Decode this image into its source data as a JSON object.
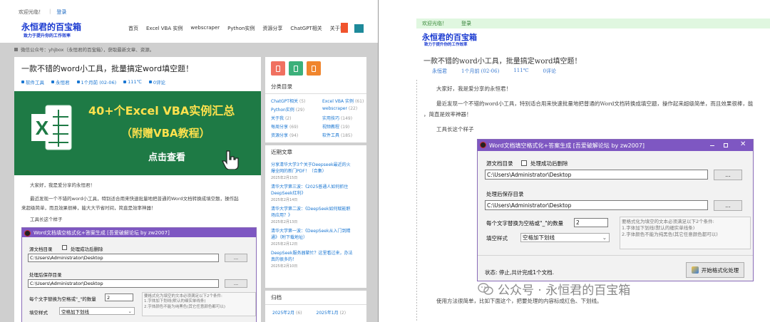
{
  "left": {
    "top_welcome": "欢迎光临！",
    "top_login": "登录",
    "site_name": "永恒君的百宝箱",
    "slogan": "致力于提升你的工作效率",
    "nav": [
      "首页",
      "Excel VBA 实例",
      "webscraper",
      "Python实例",
      "资源分享",
      "ChatGPT相关",
      "关于我"
    ],
    "breadcrumb": "微信公众号：yhjbox（永恒君的百宝箱），获取最新文章、资源。",
    "article_title": "一款不错的word小工具，批量搞定word填空题！",
    "meta": [
      "软件工具",
      "永恒君",
      "1个月前 (02-06)",
      "111℃",
      "0评论"
    ],
    "banner": {
      "line1": "40+个Excel VBA实例汇总",
      "line2": "（附赠VBA教程）",
      "line3": "点击查看"
    },
    "para1": "大家好，我是爱分享的永恒君！",
    "para2a": "最近发现一个不错的word小工具，特别适合用来快速批量地把普通的Word文档转换成填空题，操作起",
    "para2b": "来超级简单，而且效果很棒，能大大节省时间，简直是效率神器！",
    "para3": "工具长这个样子",
    "sidebar": {
      "colors": {
        "red": "#f07060",
        "green": "#3bb07a",
        "orange": "#f0852d"
      },
      "cat_heading": "分类目录",
      "categories": [
        {
          "name": "ChatGPT相关",
          "count": "(5)"
        },
        {
          "name": "Excel VBA 实例",
          "count": "(61)"
        },
        {
          "name": "Python实例",
          "count": "(29)"
        },
        {
          "name": "webscraper",
          "count": "(22)"
        },
        {
          "name": "关于我",
          "count": "(2)"
        },
        {
          "name": "实用技巧",
          "count": "(149)"
        },
        {
          "name": "每周分享",
          "count": "(69)"
        },
        {
          "name": "视频教程",
          "count": "(19)"
        },
        {
          "name": "资源分享",
          "count": "(94)"
        },
        {
          "name": "软件工具",
          "count": "(185)"
        }
      ],
      "recent_heading": "近期文章",
      "recent": [
        {
          "title_a": "分享清华大学3个关于Deepseek最近的火",
          "title_b": "爆全网的新门PDF！（合集）",
          "date": "2025年2月15日"
        },
        {
          "title_a": "清华大学第三波：《2025普通人如何抓住",
          "title_b": "DeepSeek红利》",
          "date": "2025年2月14日"
        },
        {
          "title_a": "清华大学第二波：《DeepSeek如何赋能职",
          "title_b": "场应用？》",
          "date": "2025年2月13日"
        },
        {
          "title_a": "清华大学第一波：《DeepSeek从入门到精",
          "title_b": "通》（附下载地址）",
          "date": "2025年2月12日"
        },
        {
          "title_a": "DeepSeek服务器繁忙？这里看过来，办法",
          "title_b": "真的很多的！",
          "date": "2025年2月10日"
        }
      ],
      "archive_heading": "归档",
      "archive": [
        "2025年2月",
        "(6)",
        "2025年1月",
        "(2)"
      ]
    }
  },
  "dialog": {
    "title": "Word文档填空格式化+答案生成 [吾爱破解论坛 by zw2007]",
    "source_label": "源文档目录",
    "delete_label": "处理成功后删除",
    "source_path": "C:\\Users\\Administrator\\Desktop",
    "browse_label": "...",
    "dest_label": "处理后保存目录",
    "dest_path": "C:\\Users\\Administrator\\Desktop",
    "count_label": "每个文字替换为空格或\"_\"的数量",
    "count_value": "2",
    "style_label": "填空样式",
    "style_value": "空格加下划线",
    "hint_left": [
      "要格式化为填空的文本必须满足以下2个条件:",
      "1.字体加下划线(默认的细实单线条)",
      "2.字体颜色不能为纯黑色(其它任意颜色都可以)"
    ],
    "hint_right": [
      "要格式化为填空的文本必须满足以下2个条件:",
      "1.字体加下划线(默认的细实单线条)",
      "2.字体颜色不能为纯黑色(其它任意颜色都可以)"
    ],
    "status": "状态: 停止,共计完成1个文档.",
    "start_button": "开始格式化处理"
  },
  "right": {
    "top_welcome": "欢迎光临！",
    "top_login": "登录",
    "site_name": "永恒君的百宝箱",
    "slogan": "致力于提升你的工作效率",
    "article_title": "一款不错的word小工具，批量搞定word填空题！",
    "meta": [
      "永恒君",
      "1个月前 (02-06)",
      "111℃",
      "0评论"
    ],
    "para1": "大家好，我是爱分享的永恒君！",
    "para2a": "最近发现一个不错的word小工具，特别适合用来快速批量地把普通的Word文档转换成填空题，操作起来超级简单，而且效果很棒，能",
    "para2b": "，简直是效率神器！",
    "para3": "工具长这个样子",
    "para4": "使用方法很简单，比如下面这个，把要处理的内容标成红色、下划线。",
    "watermark": "公众号 · 永恒君的百宝箱"
  }
}
